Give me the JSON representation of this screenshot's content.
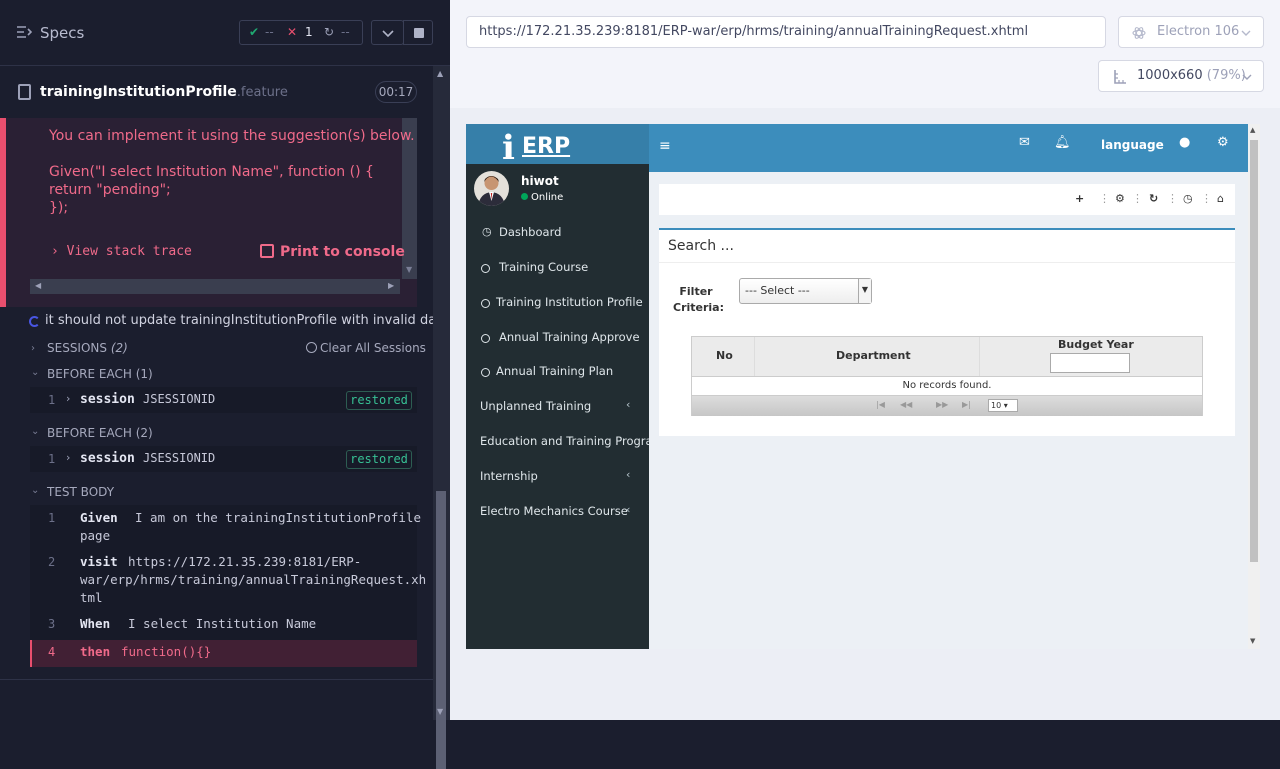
{
  "runner": {
    "specs_label": "Specs",
    "stats": {
      "passed": "--",
      "failed": "1",
      "pending": "--"
    },
    "file": {
      "name": "trainingInstitutionProfile",
      "ext": ".feature",
      "timer": "00:17"
    },
    "error": {
      "line1": "You can implement it using the suggestion(s) below.",
      "line2": "Given(\"I select Institution Name\", function () {",
      "line3": "return \"pending\";",
      "line4": "});",
      "stack": "View stack trace",
      "print": "Print to console"
    },
    "test_title": "it should not update trainingInstitutionProfile with invalid data",
    "sessions": {
      "label": "SESSIONS",
      "count": "(2)",
      "clear": "Clear All Sessions"
    },
    "before_each_1": {
      "label": "BEFORE EACH (1)",
      "num": "1",
      "cmd": "session",
      "arg": "JSESSIONID",
      "badge": "restored"
    },
    "before_each_2": {
      "label": "BEFORE EACH (2)",
      "num": "1",
      "cmd": "session",
      "arg": "JSESSIONID",
      "badge": "restored"
    },
    "test_body": {
      "label": "TEST BODY",
      "lines": [
        {
          "num": "1",
          "cmd": "Given",
          "arg": "I am on the trainingInstitutionProfile",
          "arg2": "page"
        },
        {
          "num": "2",
          "cmd": "visit",
          "arg": "https://172.21.35.239:8181/ERP-",
          "arg2": "war/erp/hrms/training/annualTrainingRequest.xh",
          "arg3": "tml"
        },
        {
          "num": "3",
          "cmd": "When",
          "arg": "I select Institution Name"
        },
        {
          "num": "4",
          "cmd": "then",
          "arg": "function(){}"
        }
      ]
    }
  },
  "browser": {
    "url": "https://172.21.35.239:8181/ERP-war/erp/hrms/training/annualTrainingRequest.xhtml",
    "name": "Electron 106",
    "viewport": "1000x660",
    "scale": "(79%)"
  },
  "app": {
    "logo_i": "i",
    "logo_text": "ERP",
    "user": "hiwot",
    "status": "Online",
    "menu": [
      {
        "label": "Dashboard"
      },
      {
        "label": "Training Course"
      },
      {
        "label": "Training Institution Profile"
      },
      {
        "label": "Annual Training Approve"
      },
      {
        "label": "Annual Training Plan"
      },
      {
        "label": "Unplanned Training"
      },
      {
        "label": "Education and Training Programs"
      },
      {
        "label": "Internship"
      },
      {
        "label": "Electro Mechanics Course"
      }
    ],
    "language": "language",
    "search_title": "Search ...",
    "filter_label": "Filter Criteria:",
    "select_value": "--- Select ---",
    "table": {
      "columns": [
        "No",
        "Department",
        "Budget Year"
      ],
      "empty": "No records found.",
      "page_size": "10"
    }
  }
}
